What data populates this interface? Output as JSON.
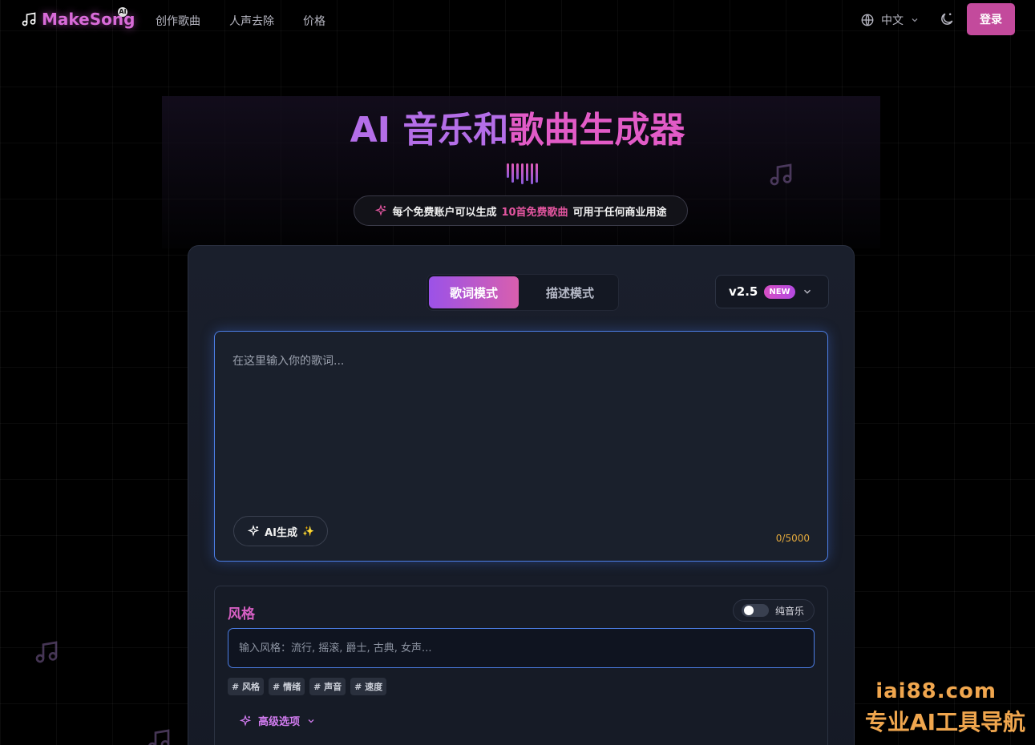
{
  "brand": {
    "name": "MakeSong",
    "badge": "AI"
  },
  "nav": [
    {
      "label": "创作歌曲"
    },
    {
      "label": "人声去除"
    },
    {
      "label": "价格"
    }
  ],
  "header": {
    "language": "中文",
    "login_label": "登录"
  },
  "hero": {
    "title_part1": "AI 音乐和",
    "title_part2": "歌曲生成器",
    "badge_prefix": "每个免费账户可以生成",
    "badge_highlight": "10首免费歌曲",
    "badge_suffix": "可用于任何商业用途"
  },
  "modes": {
    "lyrics": "歌词模式",
    "description": "描述模式"
  },
  "version": {
    "label": "v2.5",
    "badge": "NEW"
  },
  "lyrics": {
    "placeholder": "在这里输入你的歌词...",
    "ai_button": "AI生成",
    "counter": "0/5000"
  },
  "style": {
    "title": "风格",
    "pure_music": "纯音乐",
    "placeholder": "输入风格：流行, 摇滚, 爵士, 古典, 女声...",
    "tags": [
      "# 风格",
      "# 情绪",
      "# 声音",
      "# 速度"
    ],
    "advanced": "高级选项"
  },
  "watermark": {
    "line1": "iai88.com",
    "line2": "专业AI工具导航"
  },
  "colors": {
    "accent": "#c34a9c",
    "purple": "#b46ee8",
    "pink": "#e25bc7",
    "focus_blue": "#4c7ee6"
  }
}
